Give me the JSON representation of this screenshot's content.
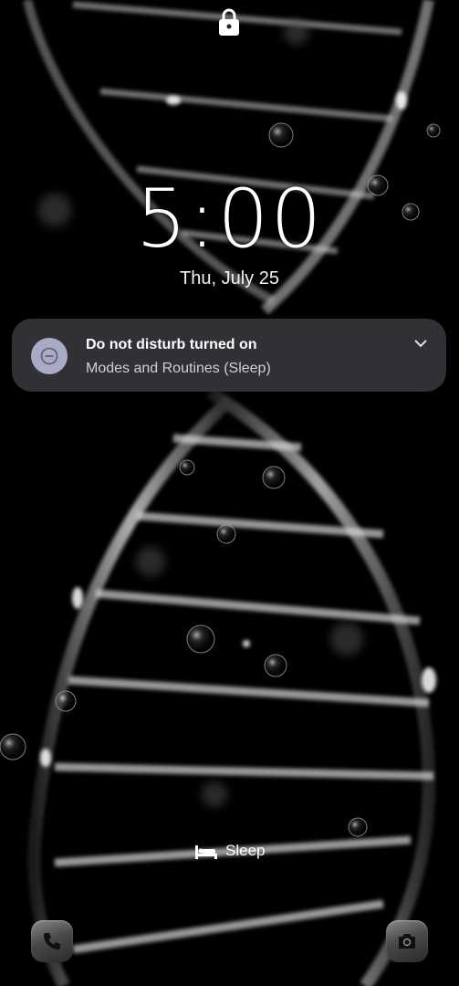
{
  "lockscreen": {
    "time": "5:00",
    "date": "Thu, July 25"
  },
  "notification": {
    "title": "Do not disturb turned on",
    "subtitle": "Modes and Routines (Sleep)",
    "icon": "do-not-disturb-icon",
    "icon_bg": "#a9abc6"
  },
  "mode_indicator": {
    "label": "Sleep",
    "icon": "bed-icon"
  },
  "shortcuts": {
    "left_icon": "phone-icon",
    "right_icon": "camera-icon"
  },
  "colors": {
    "background": "#000000",
    "notification_bg": "#37373c",
    "text_primary": "#ffffff",
    "text_secondary": "#d0d0d4"
  }
}
